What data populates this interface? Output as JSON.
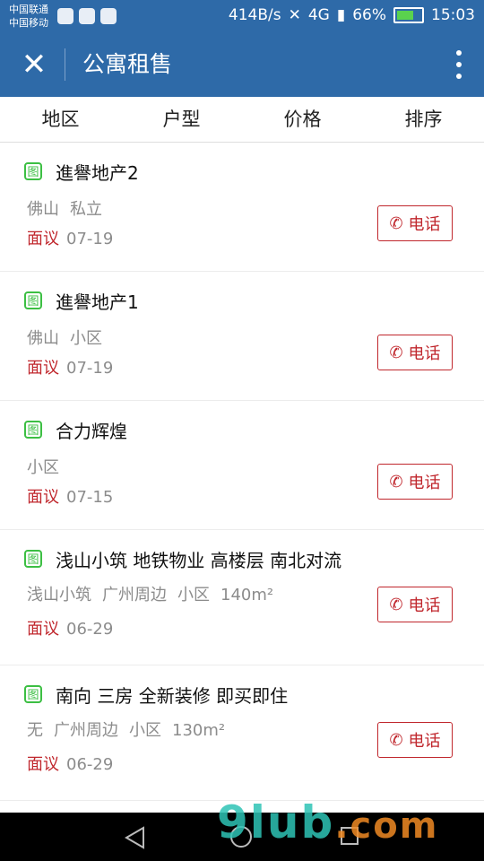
{
  "status_bar": {
    "carrier_1": "中国联通",
    "carrier_2": "中国移动",
    "net_speed": "414B/s",
    "network": "4G",
    "battery": "66%",
    "time": "15:03"
  },
  "toolbar": {
    "title": "公寓租售",
    "close_icon": "close-icon",
    "more_icon": "more-vertical-icon"
  },
  "filters": [
    "地区",
    "户型",
    "价格",
    "排序"
  ],
  "listings": [
    {
      "title": "進譽地产2",
      "tags": [
        "佛山",
        "私立"
      ],
      "price": "面议",
      "date": "07-19",
      "call_label": "电话"
    },
    {
      "title": "進譽地产1",
      "tags": [
        "佛山",
        "小区"
      ],
      "price": "面议",
      "date": "07-19",
      "call_label": "电话"
    },
    {
      "title": "合力辉煌",
      "tags": [
        "小区"
      ],
      "price": "面议",
      "date": "07-15",
      "call_label": "电话"
    },
    {
      "title": "浅山小筑 地铁物业 高楼层 南北对流",
      "tags": [
        "浅山小筑",
        "广州周边",
        "小区",
        "140m²"
      ],
      "price": "面议",
      "date": "06-29",
      "call_label": "电话"
    },
    {
      "title": "南向 三房 全新装修 即买即住",
      "tags": [
        "无",
        "广州周边",
        "小区",
        "130m²"
      ],
      "price": "面议",
      "date": "06-29",
      "call_label": "电话"
    }
  ],
  "picture_badge": "图",
  "watermark": {
    "main": "9lub",
    "suffix": ".com"
  },
  "colors": {
    "primary": "#2e6aa8",
    "accent_red": "#c0272d",
    "badge_green": "#3cbf43"
  }
}
